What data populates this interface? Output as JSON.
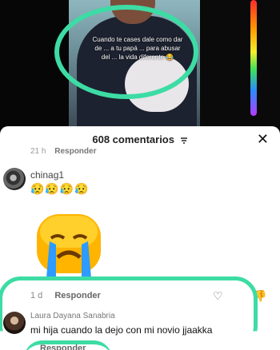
{
  "video": {
    "caption": "Cuando te cases dale como dar de ... a tu papá ... para abusar del ... la vida diferente 😂",
    "accent": "#3ddca4"
  },
  "comments_panel": {
    "title_count": "608 comentarios",
    "close_icon": "close-icon",
    "previous_reply": {
      "time": "21 h",
      "reply_label": "Responder"
    },
    "items": [
      {
        "user": "chinag1",
        "text": "😥😥😥😥",
        "sticker": "crying-emoji-sticker",
        "time": "1 d",
        "reply_label": "Responder"
      },
      {
        "user": "Laura Dayana Sanabria",
        "text": "mi hija cuando la dejo con mi novio jjaakka",
        "reply_label": "Responder"
      }
    ]
  }
}
